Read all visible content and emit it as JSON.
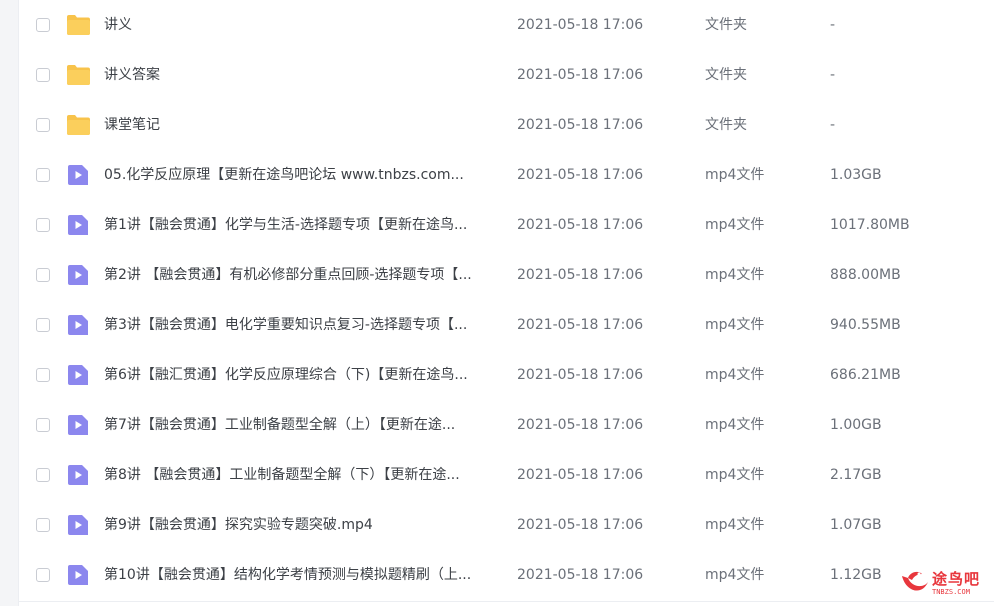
{
  "colors": {
    "folder": "#f8c34b",
    "video": "#8c87ee",
    "watermark": "#e8373d"
  },
  "files": [
    {
      "name": "讲义",
      "date": "2021-05-18 17:06",
      "type": "文件夹",
      "size": "-",
      "icon": "folder-icon"
    },
    {
      "name": "讲义答案",
      "date": "2021-05-18 17:06",
      "type": "文件夹",
      "size": "-",
      "icon": "folder-icon"
    },
    {
      "name": "课堂笔记",
      "date": "2021-05-18 17:06",
      "type": "文件夹",
      "size": "-",
      "icon": "folder-icon"
    },
    {
      "name": "05.化学反应原理【更新在途鸟吧论坛 www.tnbzs.com...",
      "date": "2021-05-18 17:06",
      "type": "mp4文件",
      "size": "1.03GB",
      "icon": "video-file-icon"
    },
    {
      "name": "第1讲【融会贯通】化学与生活-选择题专项【更新在途鸟...",
      "date": "2021-05-18 17:06",
      "type": "mp4文件",
      "size": "1017.80MB",
      "icon": "video-file-icon"
    },
    {
      "name": "第2讲 【融会贯通】有机必修部分重点回顾-选择题专项【...",
      "date": "2021-05-18 17:06",
      "type": "mp4文件",
      "size": "888.00MB",
      "icon": "video-file-icon"
    },
    {
      "name": "第3讲【融会贯通】电化学重要知识点复习-选择题专项【...",
      "date": "2021-05-18 17:06",
      "type": "mp4文件",
      "size": "940.55MB",
      "icon": "video-file-icon"
    },
    {
      "name": "第6讲【融汇贯通】化学反应原理综合（下)【更新在途鸟...",
      "date": "2021-05-18 17:06",
      "type": "mp4文件",
      "size": "686.21MB",
      "icon": "video-file-icon"
    },
    {
      "name": "第7讲【融会贯通】工业制备题型全解（上）【更新在途...",
      "date": "2021-05-18 17:06",
      "type": "mp4文件",
      "size": "1.00GB",
      "icon": "video-file-icon"
    },
    {
      "name": "第8讲 【融会贯通】工业制备题型全解（下）【更新在途...",
      "date": "2021-05-18 17:06",
      "type": "mp4文件",
      "size": "2.17GB",
      "icon": "video-file-icon"
    },
    {
      "name": "第9讲【融会贯通】探究实验专题突破.mp4",
      "date": "2021-05-18 17:06",
      "type": "mp4文件",
      "size": "1.07GB",
      "icon": "video-file-icon"
    },
    {
      "name": "第10讲【融会贯通】结构化学考情预测与模拟题精刷（上...",
      "date": "2021-05-18 17:06",
      "type": "mp4文件",
      "size": "1.12GB",
      "icon": "video-file-icon"
    }
  ],
  "watermark": {
    "text": "途鸟吧",
    "sub": "TNBZS.COM"
  }
}
